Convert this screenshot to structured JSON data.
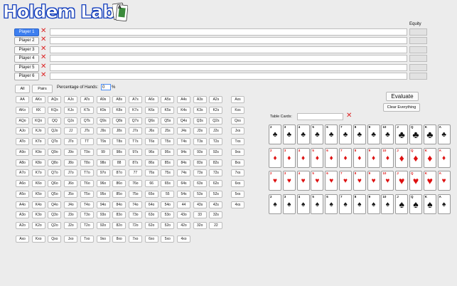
{
  "app": {
    "title": "Holdem Lab",
    "equity_label": "Equity"
  },
  "players": [
    {
      "label": "Player 1",
      "selected": true
    },
    {
      "label": "Player 2",
      "selected": false
    },
    {
      "label": "Player 3",
      "selected": false
    },
    {
      "label": "Player 4",
      "selected": false
    },
    {
      "label": "Player 5",
      "selected": false
    },
    {
      "label": "Player 6",
      "selected": false
    }
  ],
  "remove_glyph": "✕",
  "range": {
    "all_label": "All",
    "pairs_label": "Pairs",
    "pct_label": "Percentage of Hands:",
    "pct_value": "0",
    "pct_sign": "%"
  },
  "hand_grid": [
    [
      "AA",
      "AKs",
      "AQs",
      "AJs",
      "ATs",
      "A9s",
      "A8s",
      "A7s",
      "A6s",
      "A5s",
      "A4s",
      "A3s",
      "A2s"
    ],
    [
      "AKo",
      "KK",
      "KQs",
      "KJs",
      "KTs",
      "K9s",
      "K8s",
      "K7s",
      "K6s",
      "K5s",
      "K4s",
      "K3s",
      "K2s"
    ],
    [
      "AQo",
      "KQo",
      "QQ",
      "QJs",
      "QTs",
      "Q9s",
      "Q8s",
      "Q7s",
      "Q6s",
      "Q5s",
      "Q4s",
      "Q3s",
      "Q2s"
    ],
    [
      "AJo",
      "KJo",
      "QJo",
      "JJ",
      "JTs",
      "J9s",
      "J8s",
      "J7s",
      "J6s",
      "J5s",
      "J4s",
      "J3s",
      "J2s"
    ],
    [
      "ATo",
      "KTo",
      "QTo",
      "JTo",
      "TT",
      "T9s",
      "T8s",
      "T7s",
      "T6s",
      "T5s",
      "T4s",
      "T3s",
      "T2s"
    ],
    [
      "A9o",
      "K9o",
      "Q9o",
      "J9o",
      "T9o",
      "99",
      "98s",
      "97s",
      "96s",
      "95s",
      "94s",
      "93s",
      "92s"
    ],
    [
      "A8o",
      "K8o",
      "Q8o",
      "J8o",
      "T8o",
      "98o",
      "88",
      "87s",
      "86s",
      "85s",
      "84s",
      "83s",
      "82s"
    ],
    [
      "A7o",
      "K7o",
      "Q7o",
      "J7o",
      "T7o",
      "97o",
      "87o",
      "77",
      "76s",
      "75s",
      "74s",
      "73s",
      "72s"
    ],
    [
      "A6o",
      "K6o",
      "Q6o",
      "J6o",
      "T6o",
      "96o",
      "86o",
      "76o",
      "66",
      "65s",
      "64s",
      "63s",
      "62s"
    ],
    [
      "A5o",
      "K5o",
      "Q5o",
      "J5o",
      "T5o",
      "95o",
      "85o",
      "75o",
      "65o",
      "55",
      "54s",
      "53s",
      "52s"
    ],
    [
      "A4o",
      "K4o",
      "Q4o",
      "J4o",
      "T4o",
      "94o",
      "84o",
      "74o",
      "64o",
      "54o",
      "44",
      "43s",
      "42s"
    ],
    [
      "A3o",
      "K3o",
      "Q3o",
      "J3o",
      "T3o",
      "93o",
      "83o",
      "73o",
      "63o",
      "53o",
      "43o",
      "33",
      "32s"
    ],
    [
      "A2o",
      "K2o",
      "Q2o",
      "J2o",
      "T2o",
      "92o",
      "82o",
      "72o",
      "62o",
      "52o",
      "42o",
      "32o",
      "22"
    ]
  ],
  "suited_any": [
    "Axs",
    "Kxs",
    "Qxs",
    "Jxs",
    "Txs",
    "9xs",
    "8xs",
    "7xs",
    "6xs",
    "5xs",
    "4xs"
  ],
  "offsuit_any": [
    "Axo",
    "Kxo",
    "Qxo",
    "Jxo",
    "Txo",
    "9xo",
    "8xo",
    "7xo",
    "6xo",
    "5xo",
    "4xo"
  ],
  "actions": {
    "evaluate": "Evaluate",
    "clear": "Clear Everything"
  },
  "table_cards_label": "Table Cards:",
  "deck": {
    "ranks": [
      "2",
      "3",
      "4",
      "5",
      "6",
      "7",
      "8",
      "9",
      "10",
      "J",
      "Q",
      "K",
      "A"
    ],
    "suits": [
      {
        "name": "clubs",
        "glyph": "♣",
        "color": "#111111"
      },
      {
        "name": "diamonds",
        "glyph": "♦",
        "color": "#dd1111"
      },
      {
        "name": "hearts",
        "glyph": "♥",
        "color": "#dd1111"
      },
      {
        "name": "spades",
        "glyph": "♠",
        "color": "#111111"
      }
    ]
  }
}
